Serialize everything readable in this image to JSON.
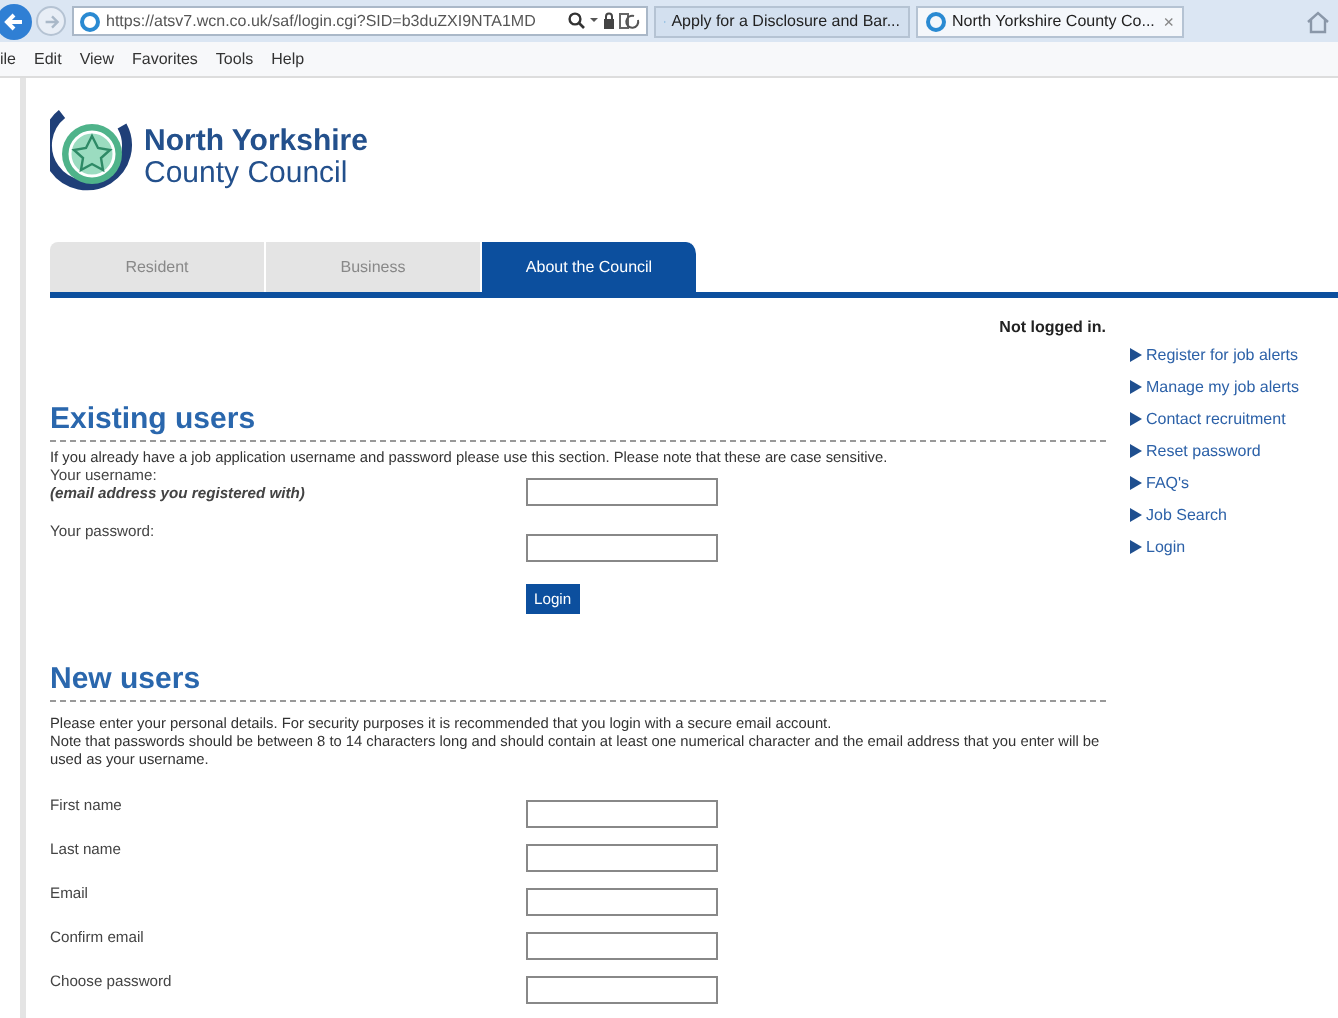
{
  "browser": {
    "address": "https://atsv7.wcn.co.uk/saf/login.cgi?SID=b3duZXI9NTA1MD",
    "tabs": [
      {
        "label": "Apply for a Disclosure and Bar...",
        "selected": false
      },
      {
        "label": "North Yorkshire County Co...",
        "selected": true,
        "close": "×"
      }
    ],
    "menu": [
      "ile",
      "Edit",
      "View",
      "Favorites",
      "Tools",
      "Help"
    ]
  },
  "logo": {
    "line1": "North Yorkshire",
    "line2": "County Council"
  },
  "nav_tabs": [
    {
      "label": "Resident",
      "selected": false
    },
    {
      "label": "Business",
      "selected": false
    },
    {
      "label": "About the Council",
      "selected": true
    }
  ],
  "status": "Not logged in.",
  "sidebar_links": [
    "Register for job alerts",
    "Manage my job alerts",
    "Contact recruitment",
    "Reset password",
    "FAQ's",
    "Job Search",
    "Login"
  ],
  "existing": {
    "heading": "Existing users",
    "intro": "If you already have a job application username and password please use this section. Please note that these are case sensitive.",
    "fields": [
      {
        "label": "Your username:",
        "hint": "(email address you registered with)"
      },
      {
        "label": "Your password:"
      }
    ],
    "button": "Login"
  },
  "new_users": {
    "heading": "New users",
    "paragraphs": [
      "Please enter your personal details. For security purposes it is recommended that you login with a secure email account.",
      "Note that passwords should be between 8 to 14 characters long and should contain at least one numerical character and the email address that you enter will be used as your username."
    ],
    "fields": [
      {
        "label": "First name"
      },
      {
        "label": "Last name"
      },
      {
        "label": "Email"
      },
      {
        "label": "Confirm email"
      },
      {
        "label": "Choose password"
      }
    ]
  }
}
